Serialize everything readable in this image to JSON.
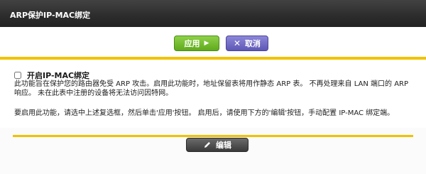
{
  "header": {
    "title": "ARP保护IP-MAC绑定"
  },
  "toolbar": {
    "apply_label": "应用",
    "cancel_label": "取消"
  },
  "settings": {
    "enable_label": "开启IP-MAC绑定",
    "enabled": false,
    "description": "此功能旨在保护您的路由器免受 ARP 攻击。启用此功能时，地址保留表将用作静态 ARP 表。 不再处理来自 LAN 端口的 ARP 响应。 未在此表中注册的设备将无法访问因特网。",
    "note": "要启用此功能，请选中上述复选框，然后单击'应用'按钮。 启用后，请使用下方的'编辑'按钮，手动配置 IP-MAC 绑定端。"
  },
  "footer": {
    "edit_label": "编辑"
  },
  "colors": {
    "apply_green": "#6fbb2a",
    "cancel_purple": "#6b65c4",
    "accent_yellow": "#f1c200",
    "title_bar": "#333333"
  }
}
